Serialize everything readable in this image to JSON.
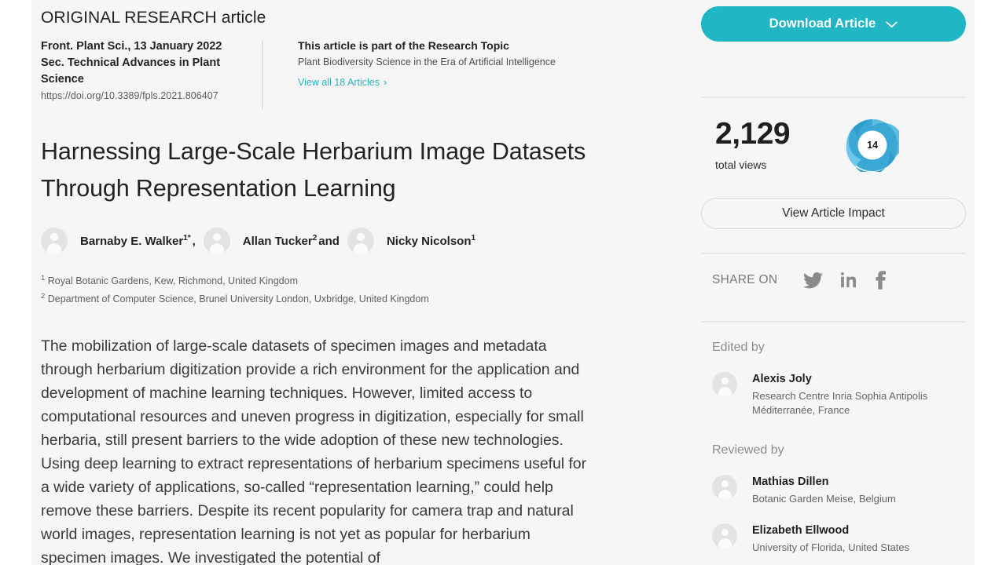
{
  "colors": {
    "accent": "#21b6c4",
    "link": "#2bb3c0",
    "canvas_bg": "#f6f6f6",
    "page_bg": "#ffffff",
    "text": "#232323",
    "muted": "#5f5f5f",
    "donut_outer": "#3aa4d0",
    "donut_inner": "#7fc9e8"
  },
  "article": {
    "type_label": "ORIGINAL RESEARCH article",
    "journal_line1": "Front. Plant Sci., 13 January 2022",
    "journal_line2": "Sec. Technical Advances in Plant",
    "journal_line3": "Science",
    "doi": "https://doi.org/10.3389/fpls.2021.806407",
    "title": "Harnessing Large-Scale Herbarium Image Datasets Through Representation Learning",
    "abstract": "The mobilization of large-scale datasets of specimen images and metadata through herbarium digitization provide a rich environment for the application and development of machine learning techniques. However, limited access to computational resources and uneven progress in digitization, especially for small herbaria, still present barriers to the wide adoption of these new technologies. Using deep learning to extract representations of herbarium specimens useful for a wide variety of applications, so-called “representation learning,” could help remove these barriers. Despite its recent popularity for camera trap and natural world images, representation learning is not yet as popular for herbarium specimen images. We investigated the potential of"
  },
  "research_topic": {
    "heading": "This article is part of the Research Topic",
    "topic_name": "Plant Biodiversity Science in the Era of Artificial Intelligence",
    "view_all_label": "View all 18 Articles",
    "chevron": "›"
  },
  "authors": [
    {
      "name": "Barnaby E. Walker",
      "sup": "1*",
      "trailing": ","
    },
    {
      "name": "Allan Tucker",
      "sup": "2",
      "trailing": " and"
    },
    {
      "name": "Nicky Nicolson",
      "sup": "1",
      "trailing": ""
    }
  ],
  "affiliations": [
    {
      "marker": "1",
      "text": "Royal Botanic Gardens, Kew, Richmond, United Kingdom"
    },
    {
      "marker": "2",
      "text": "Department of Computer Science, Brunel University London, Uxbridge, United Kingdom"
    }
  ],
  "sidebar": {
    "download_label": "Download Article",
    "download_caret": "⌄",
    "views_count": "2,129",
    "views_label": "total views",
    "altmetric_score": "14",
    "impact_label": "View Article Impact",
    "share_label": "SHARE ON",
    "share_targets": [
      "twitter",
      "linkedin",
      "facebook"
    ],
    "edited_by_heading": "Edited by",
    "reviewed_by_heading": "Reviewed by",
    "editors": [
      {
        "name": "Alexis Joly",
        "affil": "Research Centre Inria Sophia Antipolis Méditerranée, France"
      }
    ],
    "reviewers": [
      {
        "name": "Mathias Dillen",
        "affil": "Botanic Garden Meise, Belgium"
      },
      {
        "name": "Elizabeth Ellwood",
        "affil": "University of Florida, United States"
      }
    ]
  }
}
